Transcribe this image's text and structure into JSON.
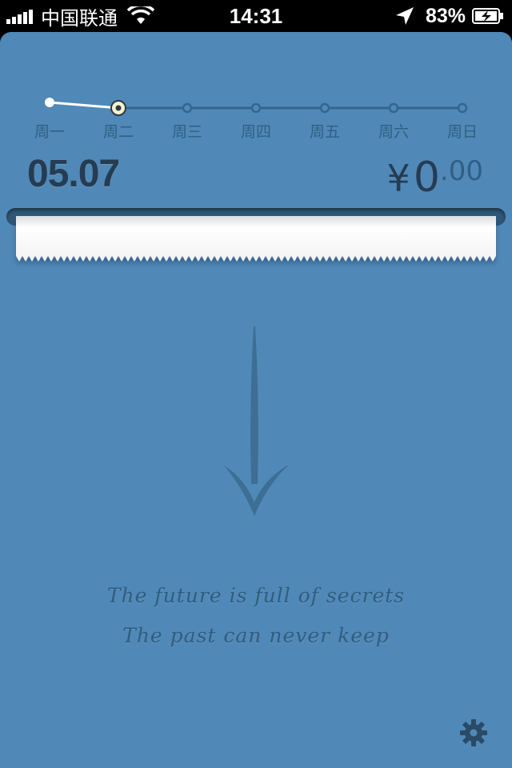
{
  "status_bar": {
    "carrier": "中国联通",
    "time": "14:31",
    "battery_percent": "83%",
    "icons": [
      "signal-icon",
      "wifi-icon",
      "location-arrow-icon",
      "battery-charging-icon"
    ]
  },
  "week": {
    "days": [
      "周一",
      "周二",
      "周三",
      "周四",
      "周五",
      "周六",
      "周日"
    ],
    "selected_index": 1,
    "values": [
      1,
      0,
      null,
      null,
      null,
      null,
      null
    ]
  },
  "summary": {
    "date": "05.07",
    "currency": "¥",
    "amount_int": "0",
    "amount_dec": ".00"
  },
  "quote": {
    "line1": "The future is full of secrets",
    "line2": "The past can never keep"
  },
  "icons": {
    "arrow": "down-arrow-icon",
    "settings": "gear-icon"
  },
  "colors": {
    "background": "#5089b8",
    "ink": "#253c52",
    "muted": "#2f5f84",
    "highlight": "#f4f1cf"
  }
}
